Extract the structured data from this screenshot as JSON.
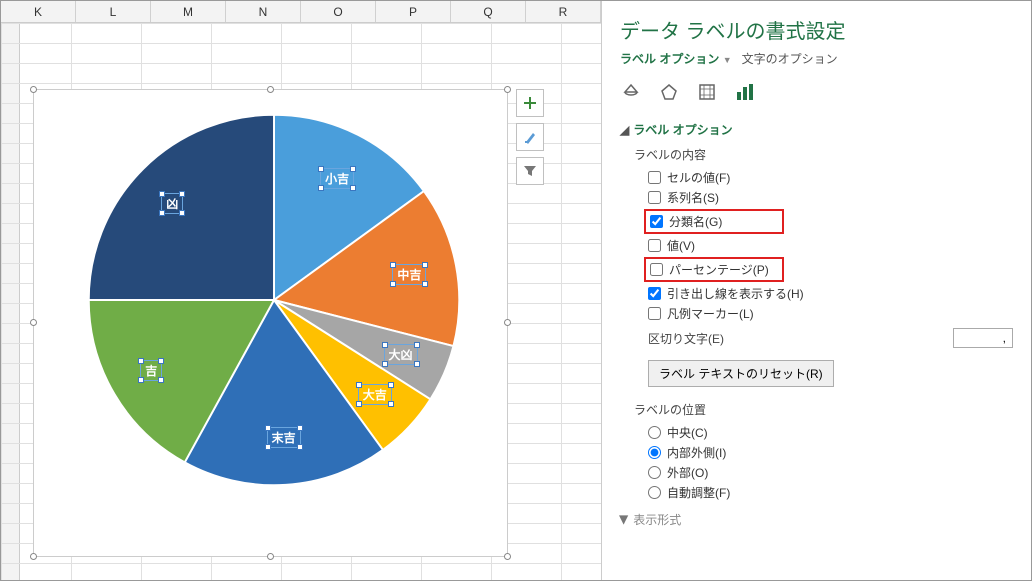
{
  "columns": [
    "K",
    "L",
    "M",
    "N",
    "O",
    "P",
    "Q",
    "R"
  ],
  "pane": {
    "title": "データ ラベルの書式設定",
    "tab_label_options": "ラベル オプション",
    "tab_text_options": "文字のオプション",
    "section_label_options": "ラベル オプション",
    "label_contents": "ラベルの内容",
    "opts": {
      "cell_value": "セルの値(F)",
      "series_name": "系列名(S)",
      "category_name": "分類名(G)",
      "value": "値(V)",
      "percentage": "パーセンテージ(P)",
      "leader_lines": "引き出し線を表示する(H)",
      "legend_marker": "凡例マーカー(L)"
    },
    "separator_label": "区切り文字(E)",
    "separator_value": ",",
    "reset_label": "ラベル テキストのリセット(R)",
    "label_position": "ラベルの位置",
    "pos": {
      "center": "中央(C)",
      "inside_end": "内部外側(I)",
      "outside": "外部(O)",
      "bestfit": "自動調整(F)"
    },
    "display_format": "表示形式"
  },
  "chart_data": {
    "type": "pie",
    "categories": [
      "小吉",
      "中吉",
      "大凶",
      "大吉",
      "末吉",
      "吉",
      "凶"
    ],
    "values": [
      15,
      14,
      5,
      6,
      18,
      17,
      25
    ],
    "colors": [
      "#4a9edb",
      "#ec7d31",
      "#a6a6a6",
      "#ffc000",
      "#2f6fb7",
      "#70ad47",
      "#264a7a"
    ],
    "title": "",
    "legend": false,
    "data_labels": "category_name"
  }
}
